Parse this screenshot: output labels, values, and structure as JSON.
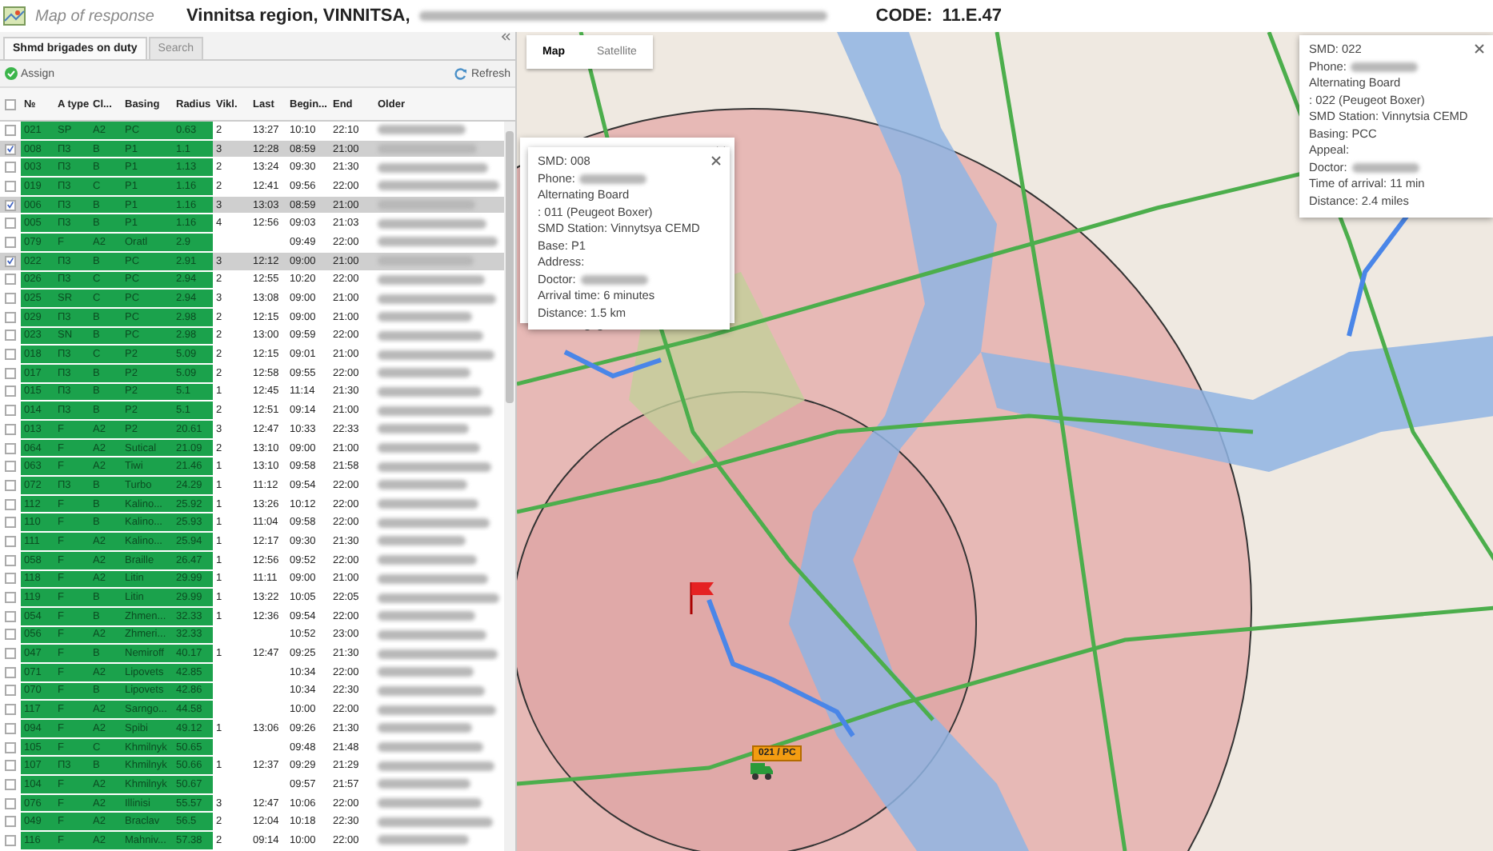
{
  "header": {
    "title": "Map of response",
    "location": "Vinnitsa region, VINNITSA,",
    "code_label": "CODE:",
    "code": "11.E.47"
  },
  "tabs": [
    {
      "label": "Shmd brigades on duty",
      "selected": true
    },
    {
      "label": "Search",
      "selected": false
    }
  ],
  "toolbar": {
    "assign": "Assign",
    "refresh": "Refresh"
  },
  "table": {
    "all_checked": false,
    "columns": [
      "№",
      "A type",
      "Cl...",
      "Basing",
      "Radius",
      "Vikl.",
      "Last",
      "Begin...",
      "End",
      "Older"
    ],
    "rows": [
      {
        "cells": [
          "021",
          "SP",
          "A2",
          "PC",
          "0.63",
          "2",
          "13:27",
          "10:10",
          "22:10"
        ],
        "checked": false
      },
      {
        "cells": [
          "008",
          "П3",
          "B",
          "P1",
          "1.1",
          "3",
          "12:28",
          "08:59",
          "21:00"
        ],
        "checked": true
      },
      {
        "cells": [
          "003",
          "П3",
          "B",
          "P1",
          "1.13",
          "2",
          "13:24",
          "09:30",
          "21:30"
        ],
        "checked": false
      },
      {
        "cells": [
          "019",
          "П3",
          "C",
          "P1",
          "1.16",
          "2",
          "12:41",
          "09:56",
          "22:00"
        ],
        "checked": false
      },
      {
        "cells": [
          "006",
          "П3",
          "B",
          "P1",
          "1.16",
          "3",
          "13:03",
          "08:59",
          "21:00"
        ],
        "checked": true
      },
      {
        "cells": [
          "005",
          "П3",
          "B",
          "P1",
          "1.16",
          "4",
          "12:56",
          "09:03",
          "21:03"
        ],
        "checked": false
      },
      {
        "cells": [
          "079",
          "F",
          "A2",
          "Oratl",
          "2.9",
          "",
          "",
          "09:49",
          "22:00"
        ],
        "checked": false
      },
      {
        "cells": [
          "022",
          "П3",
          "B",
          "PC",
          "2.91",
          "3",
          "12:12",
          "09:00",
          "21:00"
        ],
        "checked": true
      },
      {
        "cells": [
          "026",
          "П3",
          "C",
          "PC",
          "2.94",
          "2",
          "12:55",
          "10:20",
          "22:00"
        ],
        "checked": false
      },
      {
        "cells": [
          "025",
          "SR",
          "C",
          "PC",
          "2.94",
          "3",
          "13:08",
          "09:00",
          "21:00"
        ],
        "checked": false
      },
      {
        "cells": [
          "029",
          "П3",
          "B",
          "PC",
          "2.98",
          "2",
          "12:15",
          "09:00",
          "21:00"
        ],
        "checked": false
      },
      {
        "cells": [
          "023",
          "SN",
          "B",
          "PC",
          "2.98",
          "2",
          "13:00",
          "09:59",
          "22:00"
        ],
        "checked": false
      },
      {
        "cells": [
          "018",
          "П3",
          "C",
          "P2",
          "5.09",
          "2",
          "12:15",
          "09:01",
          "21:00"
        ],
        "checked": false
      },
      {
        "cells": [
          "017",
          "П3",
          "B",
          "P2",
          "5.09",
          "2",
          "12:58",
          "09:55",
          "22:00"
        ],
        "checked": false
      },
      {
        "cells": [
          "015",
          "П3",
          "B",
          "P2",
          "5.1",
          "1",
          "12:45",
          "11:14",
          "21:30"
        ],
        "checked": false
      },
      {
        "cells": [
          "014",
          "П3",
          "B",
          "P2",
          "5.1",
          "2",
          "12:51",
          "09:14",
          "21:00"
        ],
        "checked": false
      },
      {
        "cells": [
          "013",
          "F",
          "A2",
          "P2",
          "20.61",
          "3",
          "12:47",
          "10:33",
          "22:33"
        ],
        "checked": false
      },
      {
        "cells": [
          "064",
          "F",
          "A2",
          "Sutical",
          "21.09",
          "2",
          "13:10",
          "09:00",
          "21:00"
        ],
        "checked": false
      },
      {
        "cells": [
          "063",
          "F",
          "A2",
          "Tiwi",
          "21.46",
          "1",
          "13:10",
          "09:58",
          "21:58"
        ],
        "checked": false
      },
      {
        "cells": [
          "072",
          "П3",
          "B",
          "Turbo",
          "24.29",
          "1",
          "11:12",
          "09:54",
          "22:00"
        ],
        "checked": false
      },
      {
        "cells": [
          "112",
          "F",
          "B",
          "Kalino...",
          "25.92",
          "1",
          "13:26",
          "10:12",
          "22:00"
        ],
        "checked": false
      },
      {
        "cells": [
          "110",
          "F",
          "B",
          "Kalino...",
          "25.93",
          "1",
          "11:04",
          "09:58",
          "22:00"
        ],
        "checked": false
      },
      {
        "cells": [
          "111",
          "F",
          "A2",
          "Kalino...",
          "25.94",
          "1",
          "12:17",
          "09:30",
          "21:30"
        ],
        "checked": false
      },
      {
        "cells": [
          "058",
          "F",
          "A2",
          "Braille",
          "26.47",
          "1",
          "12:56",
          "09:52",
          "22:00"
        ],
        "checked": false
      },
      {
        "cells": [
          "118",
          "F",
          "A2",
          "Litin",
          "29.99",
          "1",
          "11:11",
          "09:00",
          "21:00"
        ],
        "checked": false
      },
      {
        "cells": [
          "119",
          "F",
          "B",
          "Litin",
          "29.99",
          "1",
          "13:22",
          "10:05",
          "22:05"
        ],
        "checked": false
      },
      {
        "cells": [
          "054",
          "F",
          "B",
          "Zhmen...",
          "32.33",
          "1",
          "12:36",
          "09:54",
          "22:00"
        ],
        "checked": false
      },
      {
        "cells": [
          "056",
          "F",
          "A2",
          "Zhmeri...",
          "32.33",
          "",
          "",
          "10:52",
          "23:00"
        ],
        "checked": false
      },
      {
        "cells": [
          "047",
          "F",
          "B",
          "Nemiroff",
          "40.17",
          "1",
          "12:47",
          "09:25",
          "21:30"
        ],
        "checked": false
      },
      {
        "cells": [
          "071",
          "F",
          "A2",
          "Lipovets",
          "42.85",
          "",
          "",
          "10:34",
          "22:00"
        ],
        "checked": false
      },
      {
        "cells": [
          "070",
          "F",
          "B",
          "Lipovets",
          "42.86",
          "",
          "",
          "10:34",
          "22:30"
        ],
        "checked": false
      },
      {
        "cells": [
          "117",
          "F",
          "A2",
          "Sarngo...",
          "44.58",
          "",
          "",
          "10:00",
          "22:00"
        ],
        "checked": false
      },
      {
        "cells": [
          "094",
          "F",
          "A2",
          "Spibi",
          "49.12",
          "1",
          "13:06",
          "09:26",
          "21:30"
        ],
        "checked": false
      },
      {
        "cells": [
          "105",
          "F",
          "C",
          "Khmilnyk",
          "50.65",
          "",
          "",
          "09:48",
          "21:48"
        ],
        "checked": false
      },
      {
        "cells": [
          "107",
          "П3",
          "B",
          "Khmilnyk",
          "50.66",
          "1",
          "12:37",
          "09:29",
          "21:29"
        ],
        "checked": false
      },
      {
        "cells": [
          "104",
          "F",
          "A2",
          "Khmilnyk",
          "50.67",
          "",
          "",
          "09:57",
          "21:57"
        ],
        "checked": false
      },
      {
        "cells": [
          "076",
          "F",
          "A2",
          "Illinisi",
          "55.57",
          "3",
          "12:47",
          "10:06",
          "22:00"
        ],
        "checked": false
      },
      {
        "cells": [
          "049",
          "F",
          "A2",
          "Braclav",
          "56.5",
          "2",
          "12:04",
          "10:18",
          "22:30"
        ],
        "checked": false
      },
      {
        "cells": [
          "116",
          "F",
          "A2",
          "Mahniv...",
          "57.38",
          "2",
          "09:14",
          "10:00",
          "22:00"
        ],
        "checked": false
      }
    ]
  },
  "map": {
    "tabs": [
      {
        "label": "Map",
        "selected": true
      },
      {
        "label": "Satellite",
        "selected": false
      }
    ],
    "marker_label": "021 / PC",
    "popups": [
      {
        "lines": [
          {
            "text": "SMD: 008",
            "redacted": false
          },
          {
            "text": "Phone:",
            "redacted": true
          },
          {
            "text": "Alternating Board",
            "redacted": false
          },
          {
            "text": ": 011 (Peugeot Boxer)",
            "redacted": false
          },
          {
            "text": "SMD Station: Vinnytsya CEMD",
            "redacted": false
          },
          {
            "text": "Base: P1",
            "redacted": false
          },
          {
            "text": "Address:",
            "redacted": false
          },
          {
            "text": "Doctor:",
            "redacted": true
          },
          {
            "text": "Arrival time: 6 minutes",
            "redacted": false
          },
          {
            "text": "Distance: 1.5 km",
            "redacted": false
          }
        ]
      },
      {
        "lines": [
          {
            "text": "SMD: 022",
            "redacted": false
          },
          {
            "text": "Phone:",
            "redacted": true
          },
          {
            "text": "Alternating Board",
            "redacted": false
          },
          {
            "text": ": 022 (Peugeot Boxer)",
            "redacted": false
          },
          {
            "text": "SMD Station: Vinnytsia CEMD",
            "redacted": false
          },
          {
            "text": "Basing: PCC",
            "redacted": false
          },
          {
            "text": "Appeal:",
            "redacted": false
          },
          {
            "text": "Doctor:",
            "redacted": true
          },
          {
            "text": "Time of arrival: 11 min",
            "redacted": false
          },
          {
            "text": "Distance: 2.4 miles",
            "redacted": false
          }
        ]
      }
    ]
  }
}
